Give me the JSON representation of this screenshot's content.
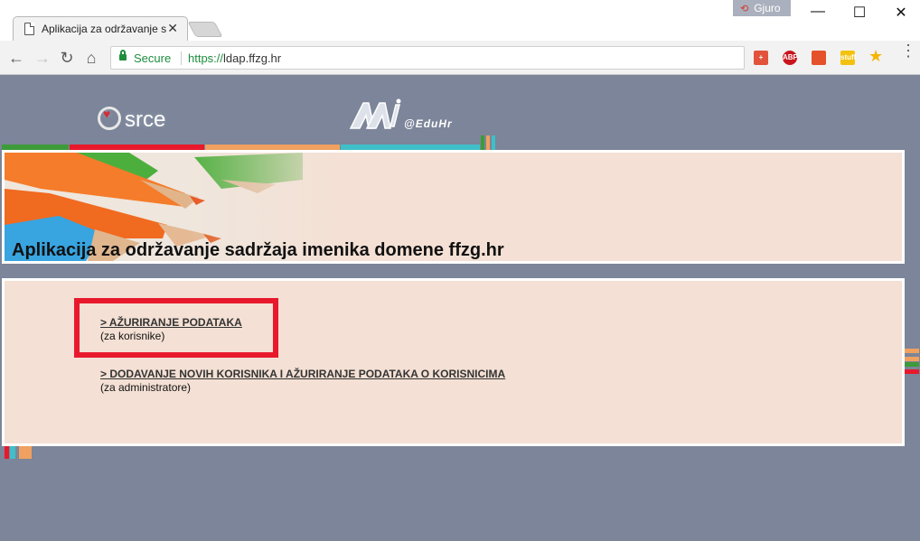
{
  "browser": {
    "tab_title": "Aplikacija za održavanje s",
    "tab_close": "✕",
    "profile_name": "Gjuro",
    "window_controls": {
      "minimize": "—",
      "maximize": "☐",
      "close": "✕"
    },
    "nav": {
      "back": "←",
      "forward": "→",
      "reload": "↻",
      "home": "⌂"
    },
    "address": {
      "security_label": "Secure",
      "scheme": "https://",
      "host": "ldap.ffzg.hr"
    },
    "extensions": [
      {
        "name": "plus-extension-icon",
        "label": "+",
        "color": "#e2533c"
      },
      {
        "name": "adblock-plus-icon",
        "label": "ABP",
        "color": "#c8161d"
      },
      {
        "name": "office-icon",
        "label": "",
        "color": "#e5512a"
      },
      {
        "name": "note-extension-icon",
        "label": "stuff",
        "color": "#f2c20f"
      }
    ],
    "bookmark_star": "★",
    "menu": "⋮"
  },
  "page": {
    "logos": {
      "srce": "srce",
      "aai": "AAI",
      "eduhr": "@EduHr"
    },
    "banner_title": "Aplikacija za održavanje sadržaja imenika domene ffzg.hr",
    "links": [
      {
        "label": "> AŽURIRANJE PODATAKA",
        "sublabel": "(za korisnike)"
      },
      {
        "label": "> DODAVANJE NOVIH KORISNIKA I AŽURIRANJE PODATAKA O KORISNICIMA",
        "sublabel": "(za administratore)"
      }
    ],
    "colors": {
      "background": "#7c8599",
      "panel": "#f4e0d4",
      "highlight": "#e8192c",
      "green": "#3d9b3a",
      "red": "#e8192c",
      "orange": "#f0a060",
      "teal": "#3fbfc8"
    }
  }
}
